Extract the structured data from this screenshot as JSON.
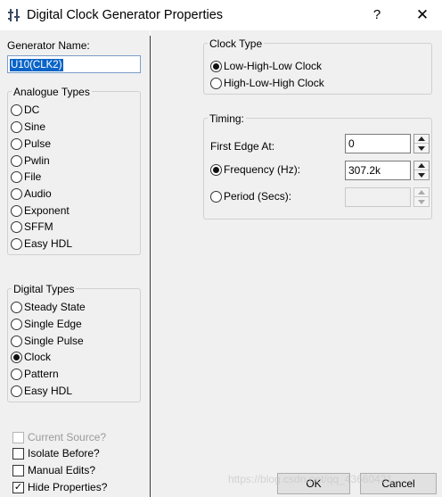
{
  "window": {
    "title": "Digital Clock Generator Properties",
    "help_label": "?",
    "close_label": "✕"
  },
  "left": {
    "generator_name_label": "Generator Name:",
    "generator_name_value": "U10(CLK2)",
    "analogue_group_title": "Analogue Types",
    "analogue_types": [
      {
        "label": "DC",
        "selected": false
      },
      {
        "label": "Sine",
        "selected": false
      },
      {
        "label": "Pulse",
        "selected": false
      },
      {
        "label": "Pwlin",
        "selected": false
      },
      {
        "label": "File",
        "selected": false
      },
      {
        "label": "Audio",
        "selected": false
      },
      {
        "label": "Exponent",
        "selected": false
      },
      {
        "label": "SFFM",
        "selected": false
      },
      {
        "label": "Easy HDL",
        "selected": false
      }
    ],
    "digital_group_title": "Digital Types",
    "digital_types": [
      {
        "label": "Steady State",
        "selected": false
      },
      {
        "label": "Single Edge",
        "selected": false
      },
      {
        "label": "Single Pulse",
        "selected": false
      },
      {
        "label": "Clock",
        "selected": true
      },
      {
        "label": "Pattern",
        "selected": false
      },
      {
        "label": "Easy HDL",
        "selected": false
      }
    ],
    "options": [
      {
        "label": "Current Source?",
        "checked": false,
        "disabled": true
      },
      {
        "label": "Isolate Before?",
        "checked": false,
        "disabled": false
      },
      {
        "label": "Manual Edits?",
        "checked": false,
        "disabled": false
      },
      {
        "label": "Hide Properties?",
        "checked": true,
        "disabled": false
      }
    ]
  },
  "clock_type": {
    "title": "Clock Type",
    "options": [
      {
        "label": "Low-High-Low Clock",
        "selected": true
      },
      {
        "label": "High-Low-High Clock",
        "selected": false
      }
    ]
  },
  "timing": {
    "title": "Timing:",
    "first_edge_label": "First Edge At:",
    "first_edge_value": "0",
    "frequency_label": "Frequency (Hz):",
    "frequency_value": "307.2k",
    "frequency_selected": true,
    "period_label": "Period (Secs):",
    "period_value": "",
    "period_selected": false
  },
  "buttons": {
    "ok_label": "OK",
    "cancel_label": "Cancel"
  },
  "watermark": "https://blog.csdn.net/qq_43660421"
}
